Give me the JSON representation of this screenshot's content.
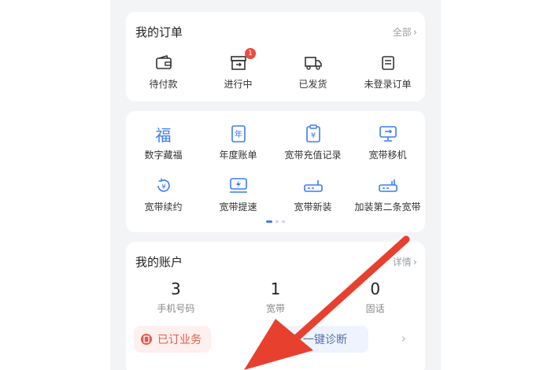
{
  "orders": {
    "title": "我的订单",
    "more": "全部",
    "items": [
      {
        "label": "待付款",
        "icon": "wallet-icon"
      },
      {
        "label": "进行中",
        "icon": "box-icon",
        "badge": "1"
      },
      {
        "label": "已发货",
        "icon": "truck-icon"
      },
      {
        "label": "未登录订单",
        "icon": "receipt-icon"
      }
    ]
  },
  "services": {
    "row1": [
      {
        "label": "数字藏福",
        "icon": "fu-character-icon",
        "glyph": "福"
      },
      {
        "label": "年度账单",
        "icon": "annual-bill-icon",
        "glyph": "年"
      },
      {
        "label": "宽带充值记录",
        "icon": "recharge-record-icon",
        "glyph": "¥"
      },
      {
        "label": "宽带移机",
        "icon": "monitor-move-icon"
      }
    ],
    "row2": [
      {
        "label": "宽带续约",
        "icon": "renew-icon",
        "glyph": "¥"
      },
      {
        "label": "宽带提速",
        "icon": "speed-up-icon"
      },
      {
        "label": "宽带新装",
        "icon": "router-icon"
      },
      {
        "label": "加装第二条宽带",
        "icon": "second-line-icon"
      }
    ],
    "pager": {
      "pages": 3,
      "active": 0
    }
  },
  "account": {
    "title": "我的账户",
    "more": "详情",
    "stats": [
      {
        "value": "3",
        "label": "手机号码"
      },
      {
        "value": "1",
        "label": "宽带"
      },
      {
        "value": "0",
        "label": "固话"
      }
    ],
    "actions": [
      {
        "label": "已订业务",
        "icon": "subscribed-icon"
      },
      {
        "label": "一键诊断",
        "icon": "diagnose-icon"
      }
    ]
  },
  "colors": {
    "accent": "#3d7cf0",
    "badge": "#f0483e",
    "arrow": "#e8402f",
    "background": "#f3f4f6"
  }
}
